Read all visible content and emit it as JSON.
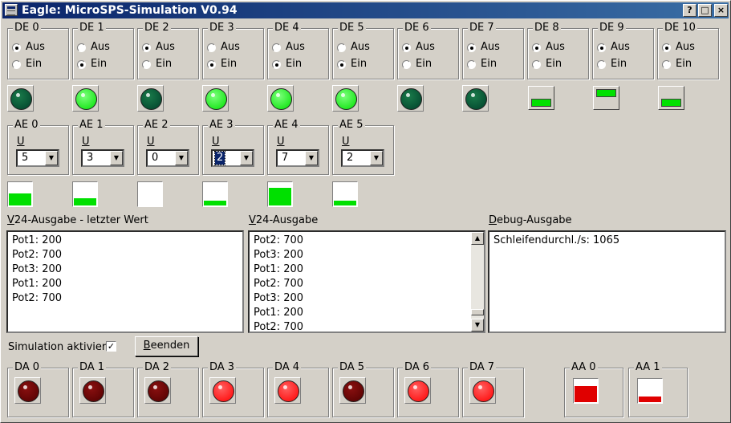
{
  "window": {
    "title": "Eagle: MicroSPS-Simulation V0.94",
    "btn_help": "?",
    "btn_max": "□",
    "btn_close": "×"
  },
  "digital_inputs": [
    {
      "label": "DE 0",
      "aus": "Aus",
      "ein": "Ein",
      "state": "aus",
      "indicator": "led-off"
    },
    {
      "label": "DE 1",
      "aus": "Aus",
      "ein": "Ein",
      "state": "ein",
      "indicator": "led-on"
    },
    {
      "label": "DE 2",
      "aus": "Aus",
      "ein": "Ein",
      "state": "aus",
      "indicator": "led-off"
    },
    {
      "label": "DE 3",
      "aus": "Aus",
      "ein": "Ein",
      "state": "ein",
      "indicator": "led-on"
    },
    {
      "label": "DE 4",
      "aus": "Aus",
      "ein": "Ein",
      "state": "ein",
      "indicator": "led-on"
    },
    {
      "label": "DE 5",
      "aus": "Aus",
      "ein": "Ein",
      "state": "ein",
      "indicator": "led-on"
    },
    {
      "label": "DE 6",
      "aus": "Aus",
      "ein": "Ein",
      "state": "aus",
      "indicator": "led-off"
    },
    {
      "label": "DE 7",
      "aus": "Aus",
      "ein": "Ein",
      "state": "aus",
      "indicator": "led-off"
    },
    {
      "label": "DE 8",
      "aus": "Aus",
      "ein": "Ein",
      "state": "aus",
      "indicator": "switch-down"
    },
    {
      "label": "DE 9",
      "aus": "Aus",
      "ein": "Ein",
      "state": "aus",
      "indicator": "switch-up"
    },
    {
      "label": "DE 10",
      "aus": "Aus",
      "ein": "Ein",
      "state": "aus",
      "indicator": "switch-down"
    }
  ],
  "analog_inputs": [
    {
      "label": "AE 0",
      "unit": "U",
      "value": "5",
      "level": 0.55,
      "focused": false
    },
    {
      "label": "AE 1",
      "unit": "U",
      "value": "3",
      "level": 0.33,
      "focused": false
    },
    {
      "label": "AE 2",
      "unit": "U",
      "value": "0",
      "level": 0.0,
      "focused": false
    },
    {
      "label": "AE 3",
      "unit": "U",
      "value": "2",
      "level": 0.22,
      "focused": true
    },
    {
      "label": "AE 4",
      "unit": "U",
      "value": "7",
      "level": 0.77,
      "focused": false
    },
    {
      "label": "AE 5",
      "unit": "U",
      "value": "2",
      "level": 0.22,
      "focused": false
    }
  ],
  "v24_last": {
    "label_accel": "V",
    "label_rest": "24-Ausgabe - letzter Wert",
    "lines": [
      "Pot1: 200",
      "Pot2: 700",
      "Pot3: 200",
      "Pot1: 200",
      "Pot2: 700"
    ]
  },
  "v24_output": {
    "label_accel": "V",
    "label_rest": "24-Ausgabe",
    "lines": [
      "Pot2: 700",
      "Pot3: 200",
      "Pot1: 200",
      "Pot2: 700",
      "Pot3: 200",
      "Pot1: 200",
      "Pot2: 700"
    ],
    "scroll_up": "▲",
    "scroll_down": "▼"
  },
  "debug_output": {
    "label_accel": "D",
    "label_rest": "ebug-Ausgabe",
    "lines": [
      "Schleifendurchl./s: 1065"
    ]
  },
  "simulation": {
    "label": "Simulation aktiviert",
    "checked_mark": "✓",
    "checked": true
  },
  "quit_button": {
    "accel": "B",
    "rest": "eenden"
  },
  "digital_outputs": [
    {
      "label": "DA 0",
      "on": false
    },
    {
      "label": "DA 1",
      "on": false
    },
    {
      "label": "DA 2",
      "on": false
    },
    {
      "label": "DA 3",
      "on": true
    },
    {
      "label": "DA 4",
      "on": true
    },
    {
      "label": "DA 5",
      "on": false
    },
    {
      "label": "DA 6",
      "on": true
    },
    {
      "label": "DA 7",
      "on": true
    }
  ],
  "analog_outputs": [
    {
      "label": "AA 0",
      "level": 0.72
    },
    {
      "label": "AA 1",
      "level": 0.25
    }
  ],
  "colors": {
    "led_on": "#00e000",
    "led_off": "#00402a",
    "out_on": "#ff0000",
    "out_off": "#500000"
  }
}
